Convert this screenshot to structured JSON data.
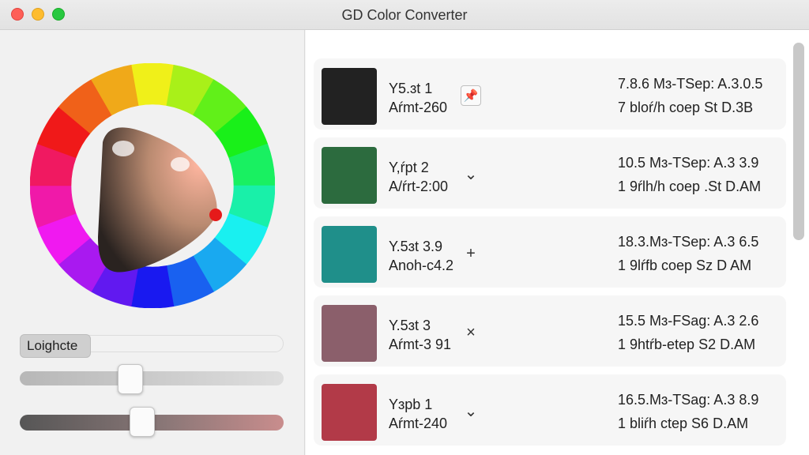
{
  "window": {
    "title": "GD Color Converter"
  },
  "left_panel": {
    "slider_label": "Loighcte",
    "slider_levels": {
      "slider_b": 0.42,
      "slider_c": 0.46
    }
  },
  "colors": [
    {
      "name": "Y5.ɜt 1",
      "sub": "Aŕmt-260",
      "swatch": "#222222",
      "action_icon": "pin-icon",
      "action_glyph": "📌",
      "meta1": "7.8.6 Mɜ-TSep: A.3.0.5",
      "meta2": "7 bloŕ/h coep  St D.3B"
    },
    {
      "name": "Y,ŕpt 2",
      "sub": "A/ŕrt-2:00",
      "swatch": "#2c6b3e",
      "action_icon": "chevron-down-icon",
      "action_glyph": "⌄",
      "meta1": "10.5 Mɜ-TSep: A.3 3.9",
      "meta2": "1 9ŕlh/h coep .St D.AM"
    },
    {
      "name": "Y.5ɜt 3.9",
      "sub": "Anoh-c4.2",
      "swatch": "#1f8f8a",
      "action_icon": "plus-icon",
      "action_glyph": "+",
      "meta1": "18.3.Mɜ-TSep: A.3 6.5",
      "meta2": "1 9lŕfb coep  Sz D AM"
    },
    {
      "name": "Y.5ɜt 3",
      "sub": "Aŕmt-3 91",
      "swatch": "#8b5f6b",
      "action_icon": "close-icon",
      "action_glyph": "×",
      "meta1": "15.5 Mɜ-FSag: A.3 2.6",
      "meta2": "1 9htŕb-etep  S2 D.AM"
    },
    {
      "name": "Yɜpb 1",
      "sub": "Aŕmt-240",
      "swatch": "#b23a48",
      "action_icon": "chevron-down-icon",
      "action_glyph": "⌄",
      "meta1": "16.5.Mɜ-TSag: A.3 8.9",
      "meta2": "1 bliŕh ctep  S6 D.AM"
    }
  ]
}
